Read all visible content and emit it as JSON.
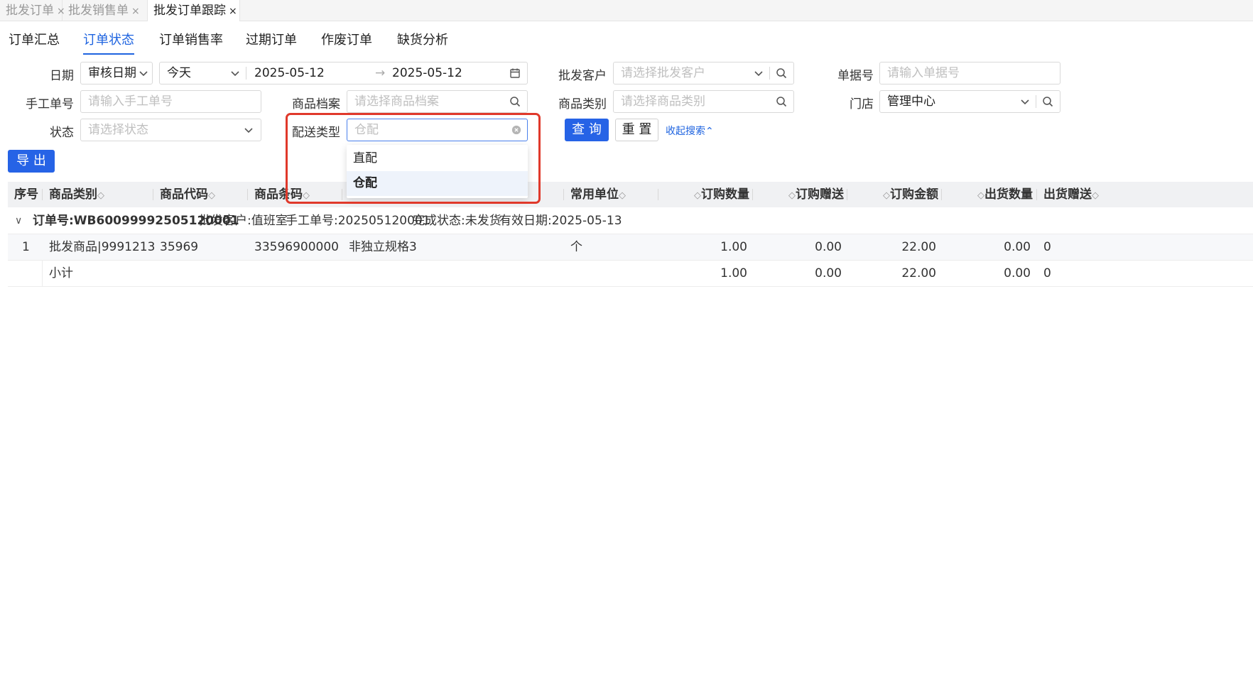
{
  "tabs": [
    {
      "label": "批发订单",
      "active": false
    },
    {
      "label": "批发销售单",
      "active": false
    },
    {
      "label": "批发订单跟踪",
      "active": true
    }
  ],
  "close_glyph": "×",
  "subtabs": [
    "订单汇总",
    "订单状态",
    "订单销售率",
    "过期订单",
    "作废订单",
    "缺货分析"
  ],
  "active_subtab": "订单状态",
  "form": {
    "date_label": "日期",
    "date_type": "审核日期",
    "date_range": "今天",
    "start_date": "2025-05-12",
    "range_arrow": "→",
    "end_date": "2025-05-12",
    "customer_label": "批发客户",
    "customer_placeholder": "请选择批发客户",
    "doc_no_label": "单据号",
    "doc_no_placeholder": "请输入单据号",
    "manual_no_label": "手工单号",
    "manual_no_placeholder": "请输入手工单号",
    "product_label": "商品档案",
    "product_placeholder": "请选择商品档案",
    "category_label": "商品类别",
    "category_placeholder": "请选择商品类别",
    "store_label": "门店",
    "store_value": "管理中心",
    "status_label": "状态",
    "status_placeholder": "请选择状态",
    "delivery_label": "配送类型",
    "delivery_placeholder": "仓配",
    "query_button": "查 询",
    "reset_button": "重 置",
    "collapse_link": "收起搜索",
    "collapse_glyph": "⌃",
    "export_button": "导 出"
  },
  "delivery_options": [
    {
      "label": "直配",
      "selected": false
    },
    {
      "label": "仓配",
      "selected": true
    }
  ],
  "table": {
    "columns": [
      "序号",
      "商品类别",
      "商品代码",
      "商品条码",
      "常用单位",
      "订购数量",
      "订购赠送",
      "订购金额",
      "出货数量",
      "出货赠送"
    ],
    "sort_glyph": "◇",
    "group": {
      "toggle": "∨",
      "order_no": "订单号:WB60099992505120001",
      "customer": "批发客户:值班室",
      "manual_no": "手工单号:202505120001",
      "status": "完成状态:未发货",
      "valid_date": "有效日期:2025-05-13"
    },
    "rows": [
      {
        "seq": "1",
        "category": "批发商品|9991213",
        "code": "35969",
        "barcode": "33596900000…",
        "spec": "非独立规格3",
        "unit": "个",
        "qty": "1.00",
        "gift": "0.00",
        "amount": "22.00",
        "ship_qty": "0.00",
        "ship_gift": "0"
      }
    ],
    "subtotal": {
      "label": "小计",
      "qty": "1.00",
      "gift": "0.00",
      "amount": "22.00",
      "ship_qty": "0.00",
      "ship_gift": "0"
    }
  },
  "colors": {
    "primary": "#2663e6",
    "highlight": "#e0392b"
  }
}
